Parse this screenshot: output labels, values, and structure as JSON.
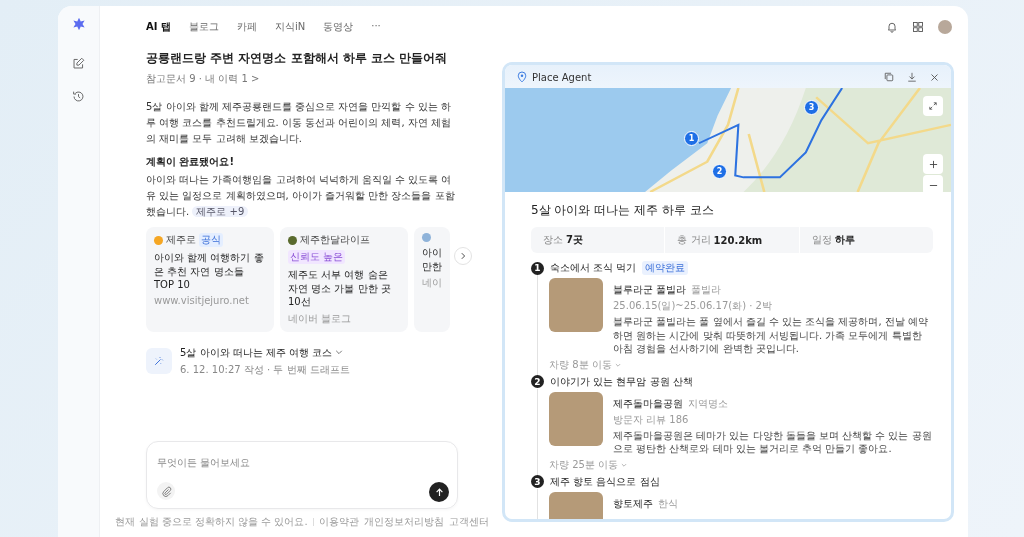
{
  "nav": {
    "tabs": [
      {
        "label": "AI 탭",
        "selected": true
      },
      {
        "label": "블로그",
        "selected": false
      },
      {
        "label": "카페",
        "selected": false
      },
      {
        "label": "지식iN",
        "selected": false
      },
      {
        "label": "동영상",
        "selected": false
      }
    ],
    "more": "···"
  },
  "chat": {
    "question": "공룡랜드랑 주변 자연명소 포함해서 하루 코스 만들어줘",
    "meta": "참고문서 9 · 내 이력 1 >",
    "intro": "5살 아이와 함께 제주공룡랜드를 중심으로 자연을 만끽할 수 있는 하루 여행 코스를 추천드릴게요. 이동 동선과 어린이의 체력, 자연 체험의 재미를 모두 고려해 보겠습니다.",
    "done_heading": "계획이 완료됐어요!",
    "done_text": "아이와 떠나는 가족여행임을 고려하여 넉넉하게 움직일 수 있도록 여유 있는 일정으로 계획하였으며, 아이가 즐거워할 만한 장소들을 포함했습니다.",
    "citation": "제주로 +9",
    "sources": [
      {
        "name": "제주로",
        "badge": "공식",
        "title": "아이와 함께 여행하기 좋은 추천 자연 명소들 TOP 10",
        "site": "www.visitjejuro.net",
        "color": "#f5a623"
      },
      {
        "name": "제주한달라이프",
        "badge": "신뢰도 높은",
        "title": "제주도 서부 여행 숨은 자연 명소 가볼 만한 곳 10선",
        "site": "네이버 블로그",
        "color": "#5a6b2e"
      },
      {
        "title": "아이 만한",
        "site": "네이",
        "color": "#8fb3d9"
      }
    ],
    "draft": {
      "title": "5살 아이와 떠나는 제주 여행 코스",
      "meta": "6. 12. 10:27 작성 · 두 번째 드래프트"
    },
    "input": {
      "placeholder": "무엇이든 물어보세요"
    },
    "footer": {
      "note": "현재 실험 중으로 정확하지 않을 수 있어요.",
      "links": [
        "이용약관",
        "개인정보처리방침",
        "고객센터"
      ]
    }
  },
  "agent": {
    "title": "Place Agent",
    "markers": [
      "1",
      "2",
      "3"
    ],
    "course_title": "5살 아이와 떠나는 제주 하루 코스",
    "stats": [
      {
        "label": "장소",
        "value": "7곳"
      },
      {
        "label": "총 거리",
        "value": "120.2km"
      },
      {
        "label": "일정",
        "value": "하루"
      }
    ],
    "steps": [
      {
        "number": "1",
        "title": "숙소에서 조식 먹기",
        "tag": "예약완료",
        "place": "블루라군 풀빌라",
        "category": "풀빌라",
        "detail": "25.06.15(일)~25.06.17(화) · 2박",
        "description": "블루라군 풀빌라는 풀 옆에서 즐길 수 있는 조식을 제공하며, 전날 예약하면 원하는 시간에 맞춰 따뜻하게 서빙됩니다. 가족 모두에게 특별한 아침 경험을 선사하기에 완벽한 곳입니다.",
        "transit": "차량 8분 이동"
      },
      {
        "number": "2",
        "title": "이야기가 있는 현무암 공원 산책",
        "place": "제주돌마을공원",
        "category": "지역명소",
        "detail": "방문자 리뷰 186",
        "description": "제주돌마을공원은 테마가 있는 다양한 돌들을 보며 산책할 수 있는 공원으로 평탄한 산책로와 테마 있는 볼거리로 추억 만들기 좋아요.",
        "transit": "차량 25분 이동"
      },
      {
        "number": "3",
        "title": "제주 향토 음식으로 점심",
        "place": "향토제주",
        "category": "한식"
      }
    ]
  }
}
